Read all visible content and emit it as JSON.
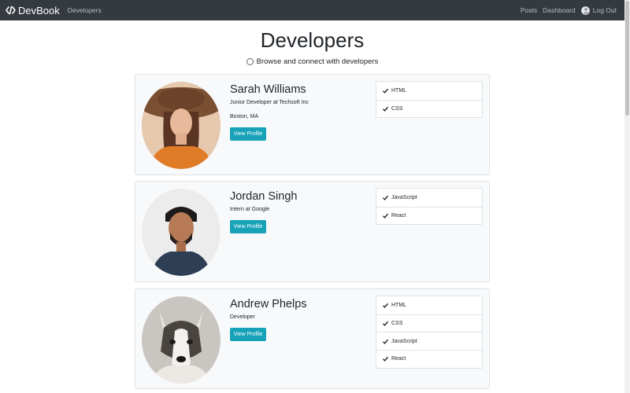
{
  "navbar": {
    "brand": "DevBook",
    "brand_icon": "code-icon",
    "left_links": [
      "Developers"
    ],
    "right_links": [
      "Posts",
      "Dashboard"
    ],
    "logout": "Log Out",
    "background": "#343a40"
  },
  "header": {
    "title": "Developers",
    "lead": "Browse and connect with developers",
    "lead_icon": "connect-icon"
  },
  "colors": {
    "accent": "#17a2b8",
    "card_bg": "#f8f9fa",
    "border": "#dee2e6"
  },
  "profiles": [
    {
      "name": "Sarah Williams",
      "status": "Junior Developer at Techsoft Inc",
      "location": "Boston, MA",
      "button": "View Profile",
      "skills": [
        "HTML",
        "CSS"
      ]
    },
    {
      "name": "Jordan Singh",
      "status": "Intern at Google",
      "location": "",
      "button": "View Profile",
      "skills": [
        "JavaScript",
        "React"
      ]
    },
    {
      "name": "Andrew Phelps",
      "status": "Developer",
      "location": "",
      "button": "View Profile",
      "skills": [
        "HTML",
        "CSS",
        "JavaScript",
        "React"
      ]
    }
  ]
}
